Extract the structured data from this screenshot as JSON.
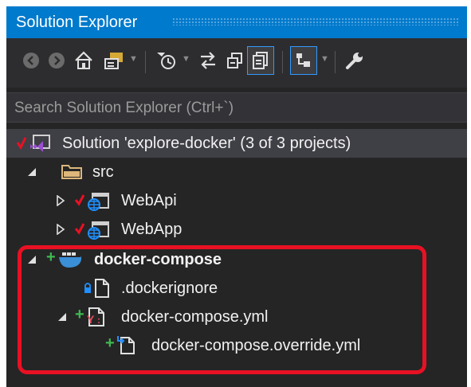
{
  "window": {
    "title": "Solution Explorer"
  },
  "toolbar": {
    "buttons": [
      {
        "name": "back-button",
        "icon": "back-arrow-icon"
      },
      {
        "name": "forward-button",
        "icon": "forward-arrow-icon"
      },
      {
        "name": "home-button",
        "icon": "home-icon"
      },
      {
        "name": "switch-views-button",
        "icon": "switch-views-icon"
      },
      {
        "name": "pending-changes-filter-button",
        "icon": "clock-filter-icon"
      },
      {
        "name": "sync-active-document-button",
        "icon": "sync-icon"
      },
      {
        "name": "collapse-all-button",
        "icon": "collapse-all-icon"
      },
      {
        "name": "show-all-files-button",
        "icon": "show-all-files-icon"
      },
      {
        "name": "preview-selected-button",
        "icon": "preview-icon"
      },
      {
        "name": "properties-button",
        "icon": "wrench-icon"
      }
    ]
  },
  "search": {
    "placeholder": "Search Solution Explorer (Ctrl+`)"
  },
  "tree": {
    "solution": "Solution 'explore-docker' (3 of 3 projects)",
    "src": "src",
    "webapi": "WebApi",
    "webapp": "WebApp",
    "docker_compose": "docker-compose",
    "dockerignore": ".dockerignore",
    "compose_yml": "docker-compose.yml",
    "override_yml": "docker-compose.override.yml"
  },
  "colors": {
    "titlebar": "#007acc",
    "panel": "#252526",
    "highlight": "#e81123",
    "git_added": "#3fb950",
    "git_checked": "#e81123"
  }
}
